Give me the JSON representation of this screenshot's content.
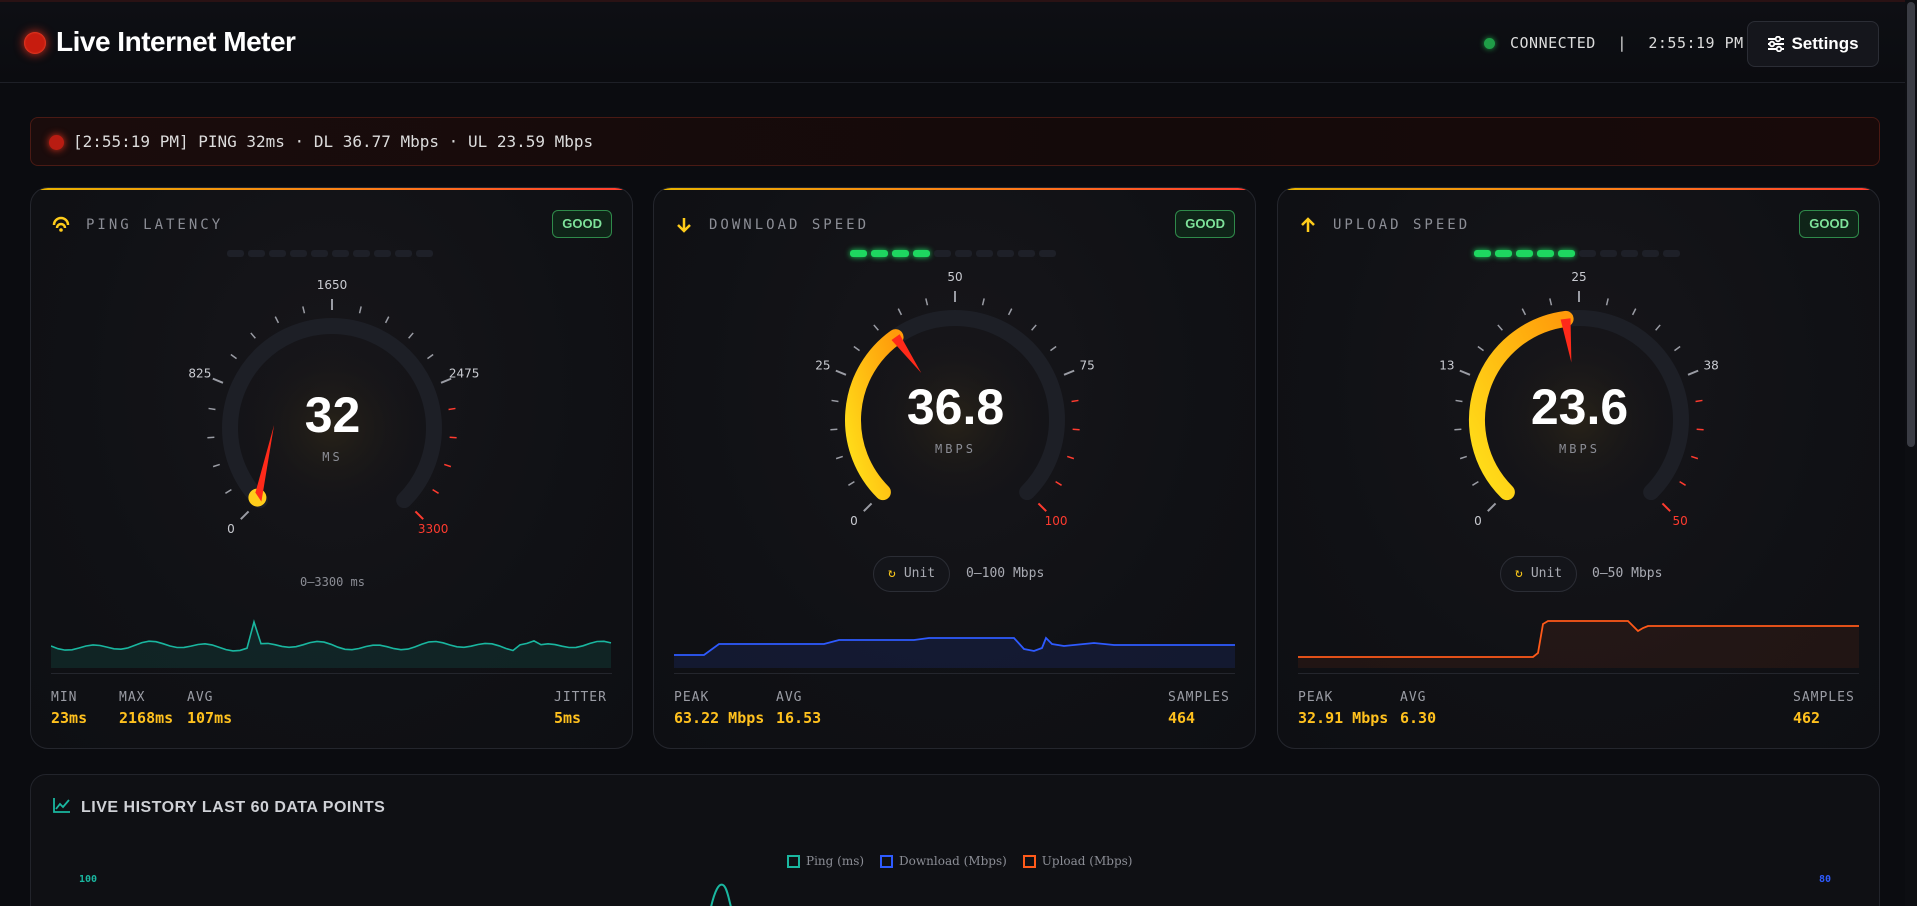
{
  "app": {
    "title": "Live Internet Meter",
    "status": "CONNECTED",
    "separator": "|",
    "time": "2:55:19 PM",
    "settings_label": "Settings"
  },
  "banner": {
    "text": "[2:55:19 PM] PING 32ms · DL 36.77 Mbps · UL 23.59 Mbps"
  },
  "ping": {
    "title": "PING LATENCY",
    "badge": "GOOD",
    "value": "32",
    "unit": "MS",
    "range": "0–3300 ms",
    "ticks": [
      "0",
      "825",
      "1650",
      "2475",
      "3300"
    ],
    "gauge_fraction": 0.01,
    "activity_level": 0,
    "stats": [
      {
        "label": "MIN",
        "value": "23ms"
      },
      {
        "label": "MAX",
        "value": "2168ms"
      },
      {
        "label": "AVG",
        "value": "107ms"
      },
      {
        "label": "JITTER",
        "value": "5ms"
      }
    ]
  },
  "download": {
    "title": "DOWNLOAD SPEED",
    "badge": "GOOD",
    "value": "36.8",
    "unit": "MBPS",
    "unit_button": "Unit",
    "range": "0–100 Mbps",
    "ticks": [
      "0",
      "25",
      "50",
      "75",
      "100"
    ],
    "gauge_fraction": 0.368,
    "activity_level": 4,
    "stats": [
      {
        "label": "PEAK",
        "value": "63.22 Mbps"
      },
      {
        "label": "AVG",
        "value": "16.53"
      },
      {
        "label": "SAMPLES",
        "value": "464"
      }
    ]
  },
  "upload": {
    "title": "UPLOAD SPEED",
    "badge": "GOOD",
    "value": "23.6",
    "unit": "MBPS",
    "unit_button": "Unit",
    "range": "0–50 Mbps",
    "ticks": [
      "0",
      "13",
      "25",
      "38",
      "50"
    ],
    "gauge_fraction": 0.472,
    "activity_level": 5,
    "stats": [
      {
        "label": "PEAK",
        "value": "32.91 Mbps"
      },
      {
        "label": "AVG",
        "value": "6.30"
      },
      {
        "label": "SAMPLES",
        "value": "462"
      }
    ]
  },
  "history": {
    "title": "LIVE HISTORY LAST 60 DATA POINTS",
    "legend": [
      "Ping (ms)",
      "Download (Mbps)",
      "Upload (Mbps)"
    ],
    "legend_colors": [
      "#1ab7a0",
      "#2e5bff",
      "#ff5a1a"
    ],
    "y_left_top": "100",
    "y_right_top": "80"
  },
  "colors": {
    "ping_spark": "#1ab7a0",
    "download_spark": "#2e5bff",
    "upload_spark": "#ff5a1a",
    "gauge_fill_start": "#ffe21a",
    "gauge_fill_end": "#ff9a0a",
    "needle": "#ff2a1a"
  }
}
